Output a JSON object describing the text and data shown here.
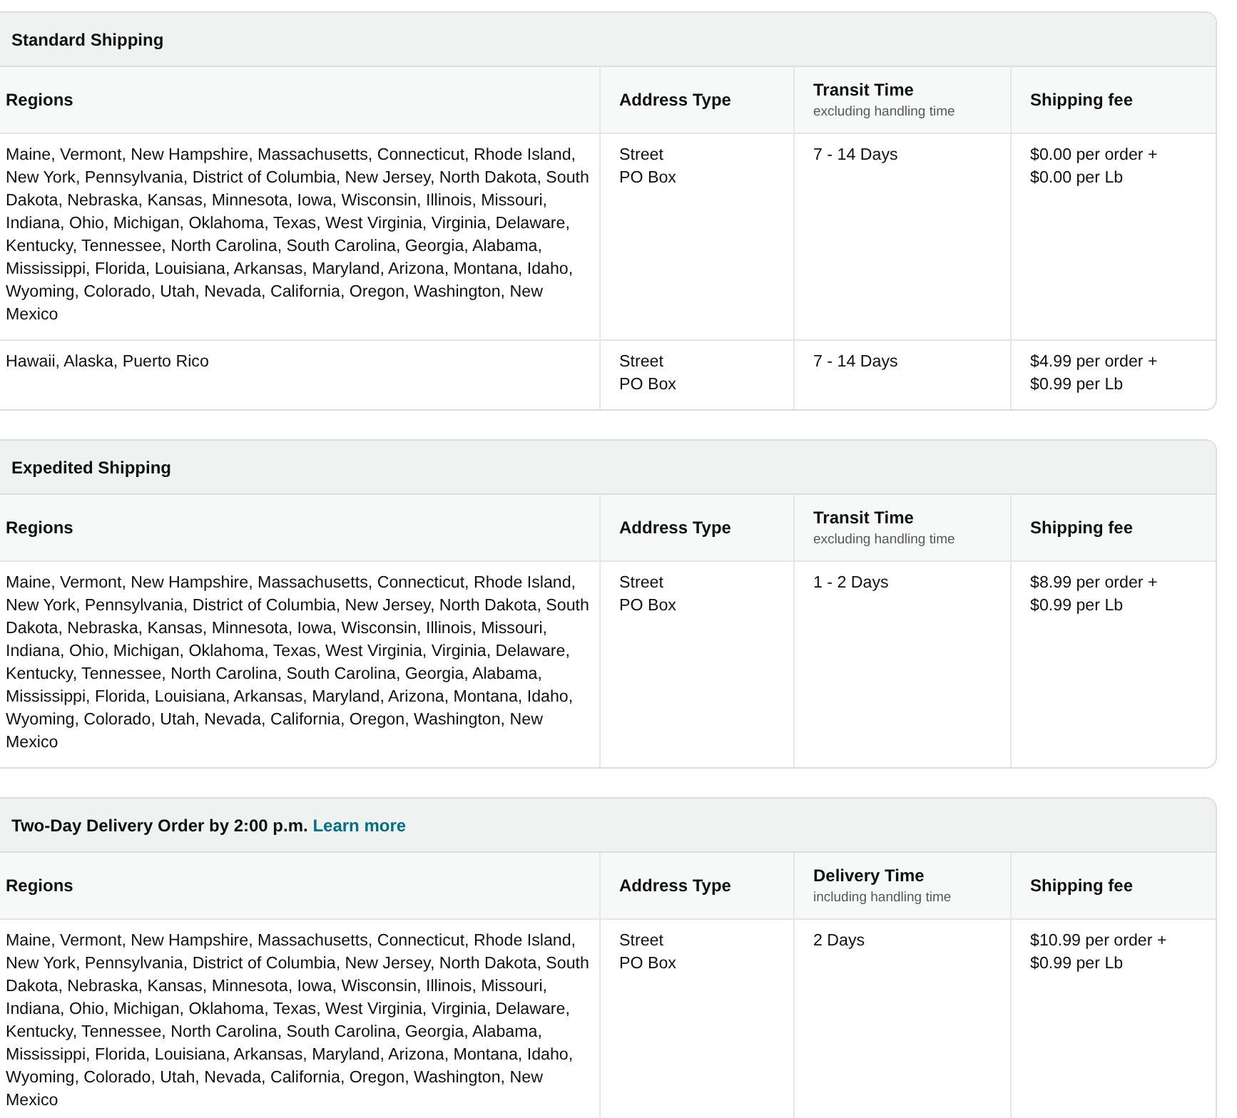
{
  "sections": [
    {
      "title": "Standard Shipping",
      "columns": [
        {
          "label": "Regions"
        },
        {
          "label": "Address Type"
        },
        {
          "label": "Transit Time",
          "note": "excluding handling time"
        },
        {
          "label": "Shipping fee"
        }
      ],
      "rows": [
        {
          "regions": "Maine, Vermont, New Hampshire, Massachusetts, Connecticut, Rhode Island, New York, Pennsylvania, District of Columbia, New Jersey, North Dakota, South Dakota, Nebraska, Kansas, Minnesota, Iowa, Wisconsin, Illinois, Missouri, Indiana, Ohio, Michigan, Oklahoma, Texas, West Virginia, Virginia, Delaware, Kentucky, Tennessee, North Carolina, South Carolina, Georgia, Alabama, Mississippi, Florida, Louisiana, Arkansas, Maryland, Arizona, Montana, Idaho, Wyoming, Colorado, Utah, Nevada, California, Oregon, Washington, New Mexico",
          "address_types": [
            "Street",
            "PO Box"
          ],
          "time": "7 - 14 Days",
          "fee": [
            "$0.00 per order +",
            "$0.00 per Lb"
          ]
        },
        {
          "regions": "Hawaii, Alaska, Puerto Rico",
          "address_types": [
            "Street",
            "PO Box"
          ],
          "time": "7 - 14 Days",
          "fee": [
            "$4.99 per order +",
            "$0.99 per Lb"
          ]
        }
      ]
    },
    {
      "title": "Expedited Shipping",
      "columns": [
        {
          "label": "Regions"
        },
        {
          "label": "Address Type"
        },
        {
          "label": "Transit Time",
          "note": "excluding handling time"
        },
        {
          "label": "Shipping fee"
        }
      ],
      "rows": [
        {
          "regions": "Maine, Vermont, New Hampshire, Massachusetts, Connecticut, Rhode Island, New York, Pennsylvania, District of Columbia, New Jersey, North Dakota, South Dakota, Nebraska, Kansas, Minnesota, Iowa, Wisconsin, Illinois, Missouri, Indiana, Ohio, Michigan, Oklahoma, Texas, West Virginia, Virginia, Delaware, Kentucky, Tennessee, North Carolina, South Carolina, Georgia, Alabama, Mississippi, Florida, Louisiana, Arkansas, Maryland, Arizona, Montana, Idaho, Wyoming, Colorado, Utah, Nevada, California, Oregon, Washington, New Mexico",
          "address_types": [
            "Street",
            "PO Box"
          ],
          "time": "1 - 2 Days",
          "fee": [
            "$8.99 per order +",
            "$0.99 per Lb"
          ]
        }
      ]
    },
    {
      "title": "Two-Day Delivery Order by 2:00 p.m.",
      "link": "Learn more",
      "columns": [
        {
          "label": "Regions"
        },
        {
          "label": "Address Type"
        },
        {
          "label": "Delivery Time",
          "note": "including handling time"
        },
        {
          "label": "Shipping fee"
        }
      ],
      "rows": [
        {
          "regions": "Maine, Vermont, New Hampshire, Massachusetts, Connecticut, Rhode Island, New York, Pennsylvania, District of Columbia, New Jersey, North Dakota, South Dakota, Nebraska, Kansas, Minnesota, Iowa, Wisconsin, Illinois, Missouri, Indiana, Ohio, Michigan, Oklahoma, Texas, West Virginia, Virginia, Delaware, Kentucky, Tennessee, North Carolina, South Carolina, Georgia, Alabama, Mississippi, Florida, Louisiana, Arkansas, Maryland, Arizona, Montana, Idaho, Wyoming, Colorado, Utah, Nevada, California, Oregon, Washington, New Mexico",
          "address_types": [
            "Street",
            "PO Box"
          ],
          "time": "2 Days",
          "fee": [
            "$10.99 per order +",
            "$0.99 per Lb"
          ]
        }
      ]
    }
  ]
}
